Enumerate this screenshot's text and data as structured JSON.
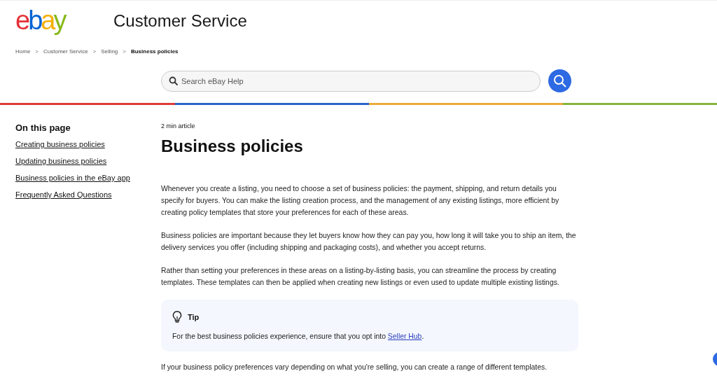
{
  "header": {
    "logo": [
      {
        "text": "e",
        "color": "#e53238"
      },
      {
        "text": "b",
        "color": "#0064d2"
      },
      {
        "text": "a",
        "color": "#f5af02"
      },
      {
        "text": "y",
        "color": "#86b817"
      }
    ],
    "title": "Customer Service"
  },
  "breadcrumb": [
    {
      "label": "Home",
      "current": false
    },
    {
      "label": "Customer Service",
      "current": false
    },
    {
      "label": "Selling",
      "current": false
    },
    {
      "label": "Business policies",
      "current": true
    }
  ],
  "breadcrumb_separator": ">",
  "search": {
    "placeholder": "Search eBay Help"
  },
  "sidebar": {
    "title": "On this page",
    "items": [
      "Creating business policies",
      "Updating business policies",
      "Business policies in the eBay app",
      "Frequently Asked Questions"
    ]
  },
  "article": {
    "meta": "2 min article",
    "title": "Business policies",
    "paragraphs": [
      "Whenever you create a listing, you need to choose a set of business policies: the payment, shipping, and return details you specify for buyers. You can make the listing creation process, and the management of any existing listings, more efficient by creating policy templates that store your preferences for each of these areas.",
      "Business policies are important because they let buyers know how they can pay you, how long it will take you to ship an item, the delivery services you offer (including shipping and packaging costs), and whether you accept returns.",
      "Rather than setting your preferences in these areas on a listing-by-listing basis, you can streamline the process by creating templates. These templates can then be applied when creating new listings or even used to update multiple existing listings."
    ],
    "tip": {
      "title": "Tip",
      "before": "For the best business policies experience, ensure that you opt into ",
      "link": "Seller Hub",
      "after": "."
    },
    "after_tip": "If your business policy preferences vary depending on what you're selling, you can create a range of different templates."
  }
}
